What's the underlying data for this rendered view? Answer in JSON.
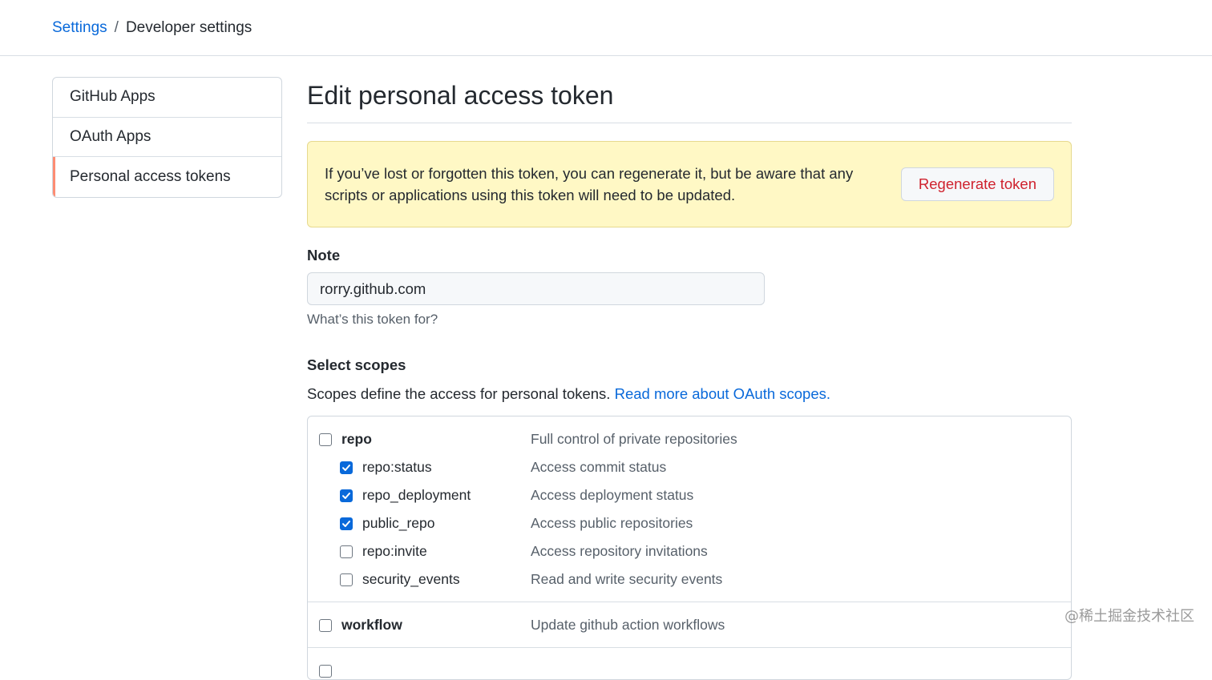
{
  "breadcrumb": {
    "settings": "Settings",
    "separator": "/",
    "current": "Developer settings"
  },
  "sidebar": {
    "items": [
      {
        "label": "GitHub Apps"
      },
      {
        "label": "OAuth Apps"
      },
      {
        "label": "Personal access tokens"
      }
    ]
  },
  "main": {
    "title": "Edit personal access token",
    "flash": {
      "text": "If you’ve lost or forgotten this token, you can regenerate it, but be aware that any scripts or applications using this token will need to be updated.",
      "button": "Regenerate token"
    },
    "note": {
      "label": "Note",
      "value": "rorry.github.com",
      "hint": "What’s this token for?"
    },
    "scopes": {
      "title": "Select scopes",
      "desc": "Scopes define the access for personal tokens.",
      "link": "Read more about OAuth scopes.",
      "repo": {
        "name": "repo",
        "desc": "Full control of private repositories",
        "checked": false,
        "children": [
          {
            "name": "repo:status",
            "desc": "Access commit status",
            "checked": true
          },
          {
            "name": "repo_deployment",
            "desc": "Access deployment status",
            "checked": true
          },
          {
            "name": "public_repo",
            "desc": "Access public repositories",
            "checked": true
          },
          {
            "name": "repo:invite",
            "desc": "Access repository invitations",
            "checked": false
          },
          {
            "name": "security_events",
            "desc": "Read and write security events",
            "checked": false
          }
        ]
      },
      "workflow": {
        "name": "workflow",
        "desc": "Update github action workflows",
        "checked": false
      }
    }
  },
  "watermark": "@稀土掘金技术社区",
  "colors": {
    "link": "#0969da",
    "danger": "#cf222e",
    "flash_bg": "#fff8c5",
    "selected_marker": "#fd8c73",
    "checkbox_checked": "#0969da"
  }
}
